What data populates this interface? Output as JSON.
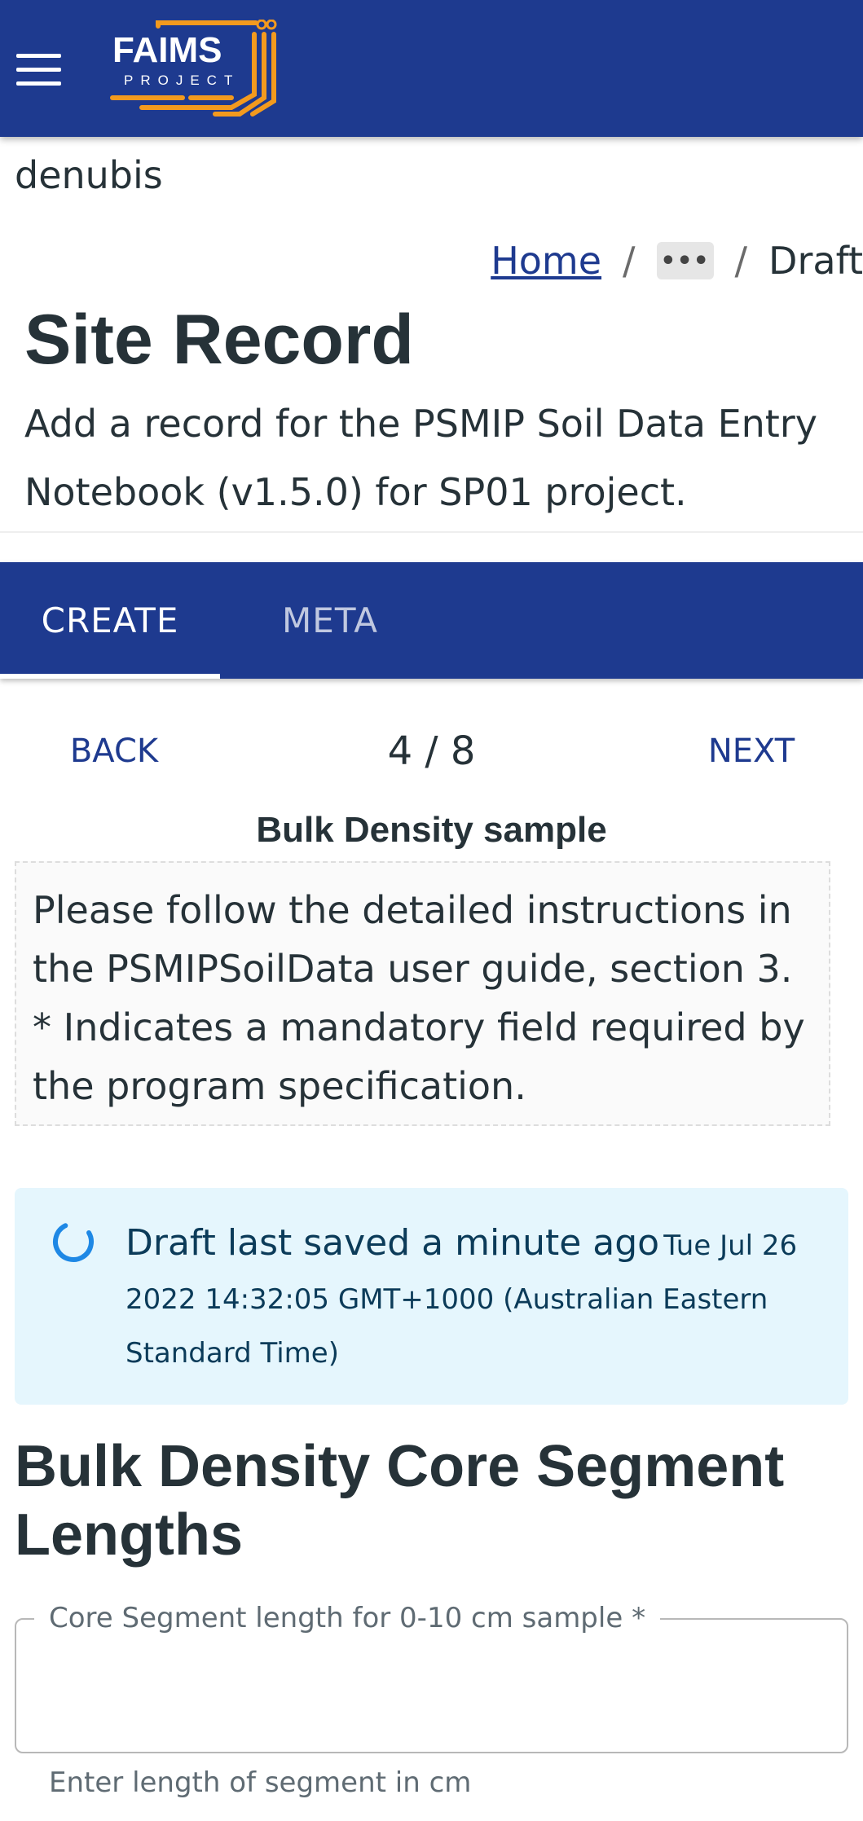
{
  "header": {
    "logo_text": "FAIMS",
    "logo_subtext": "PROJECT",
    "brand_color": "#1e3a8f",
    "logo_color": "#f39a1e"
  },
  "user": {
    "name": "denubis"
  },
  "breadcrumb": {
    "home": "Home",
    "more": "•••",
    "current": "Draft"
  },
  "page": {
    "title": "Site Record",
    "subtitle": "Add a record for the PSMIP Soil Data Entry Notebook (v1.5.0) for SP01 project."
  },
  "tabs": [
    {
      "label": "CREATE",
      "active": true
    },
    {
      "label": "META",
      "active": false
    }
  ],
  "stepper": {
    "back": "BACK",
    "position": "4 / 8",
    "next": "NEXT"
  },
  "section": {
    "heading": "Bulk Density sample",
    "instructions": "Please follow the detailed instructions in the PSMIPSoilData user guide, section 3. * Indicates a mandatory field required by the program specification."
  },
  "draft_alert": {
    "icon": "spinner-icon",
    "message": "Draft last saved a minute ago",
    "date": "Tue Jul 26 2022 14:32:05 GMT+1000 (Australian Eastern Standard Time)",
    "background": "#e5f6fd"
  },
  "form": {
    "heading": "Bulk Density Core Segment Lengths",
    "fields": [
      {
        "label": "Core Segment length for 0-10 cm sample *",
        "value": "",
        "helper": "Enter length of segment in cm"
      }
    ]
  }
}
